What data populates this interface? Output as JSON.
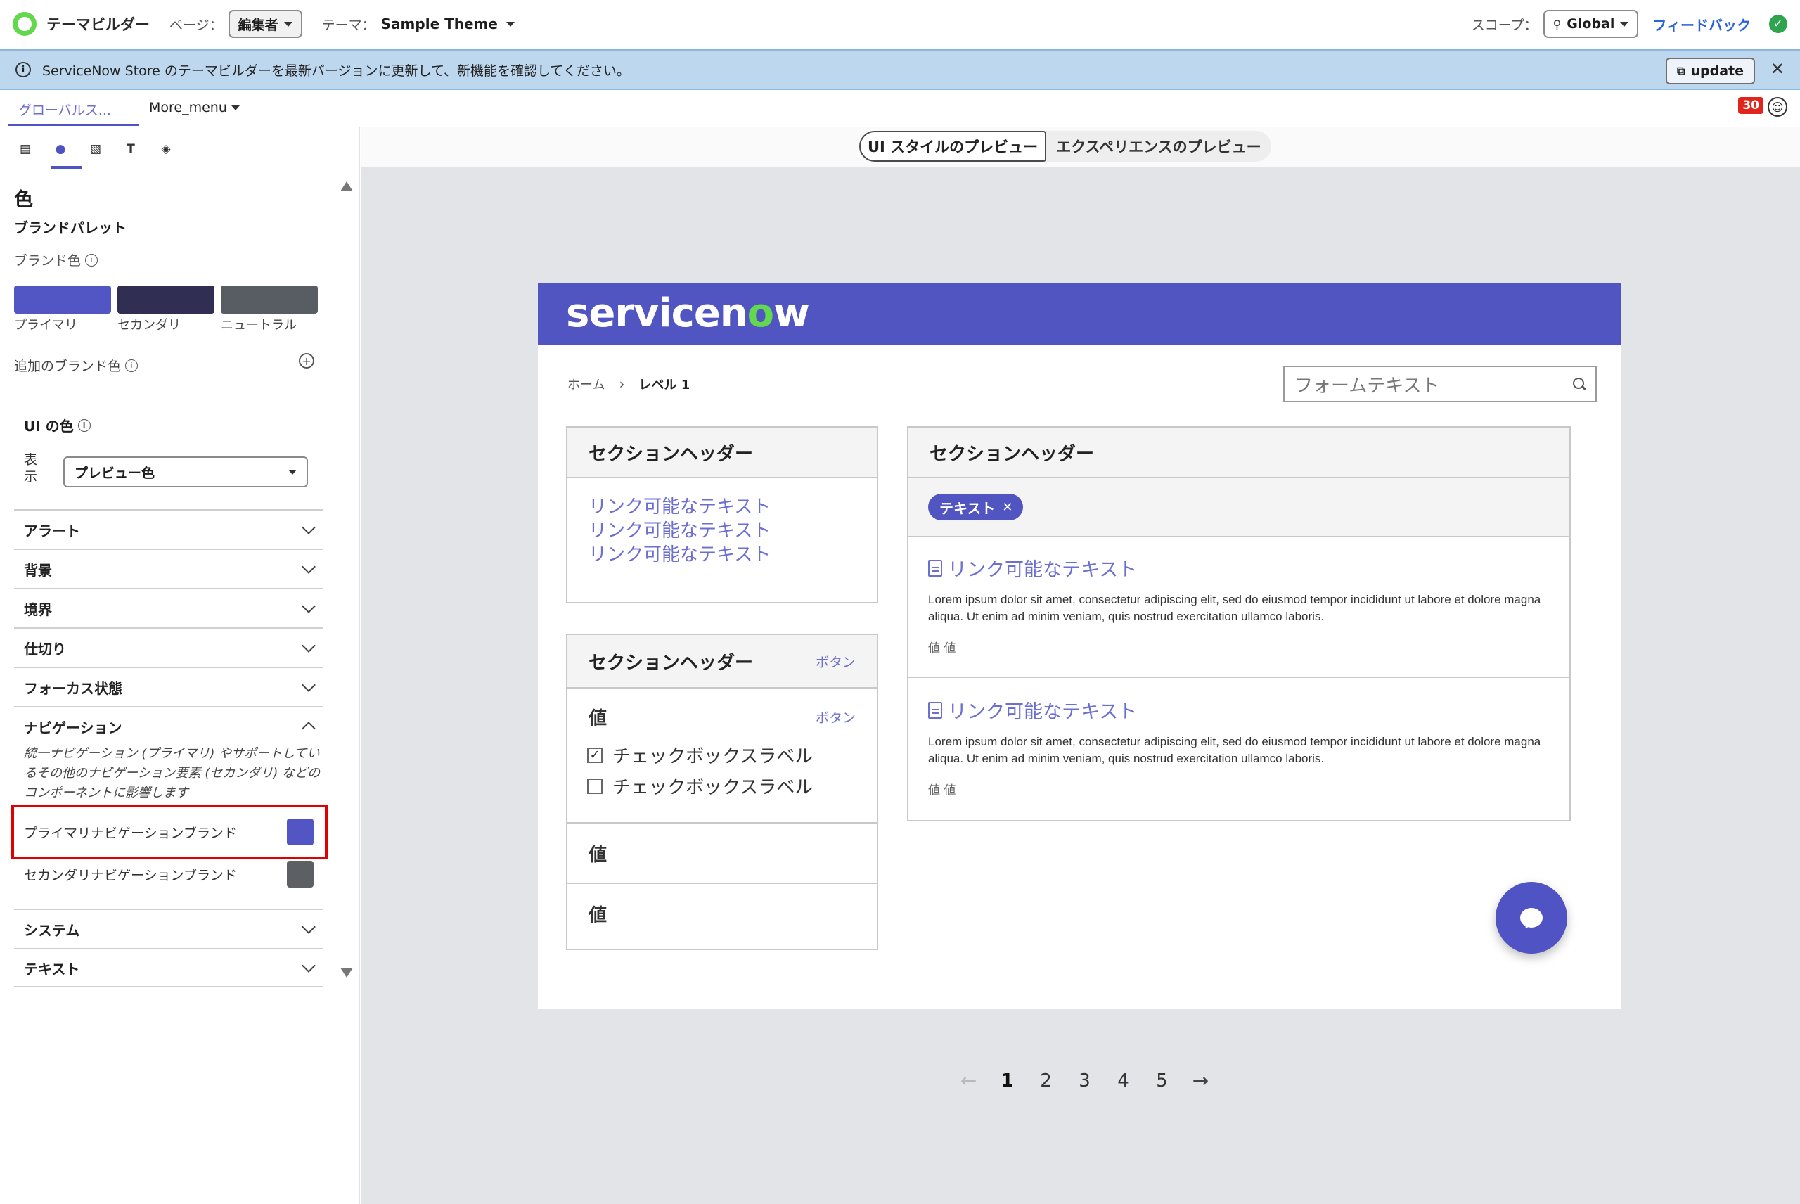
{
  "topbar": {
    "app_title": "テーマビルダー",
    "page_label": "ページ：",
    "page_value": "編集者",
    "theme_label": "テーマ：",
    "theme_value": "Sample Theme",
    "scope_label": "スコープ：",
    "scope_value": "Global",
    "feedback_link": "フィードバック",
    "status_icon": "check-circle-icon"
  },
  "banner": {
    "text": "ServiceNow Store のテーマビルダーを最新バージョンに更新して、新機能を確認してください。",
    "update_label": "update",
    "close_icon": "close-icon"
  },
  "tabs": {
    "global_tab": "グローバルス...",
    "more_menu": "More_menu",
    "notification_count": "30"
  },
  "panel": {
    "icon_tabs": [
      "layout-icon",
      "color-icon",
      "image-icon",
      "typography-icon",
      "shape-icon"
    ],
    "section_title": "色",
    "palette_title": "ブランドパレット",
    "brand_color_label": "ブランド色",
    "swatches": [
      {
        "label": "プライマリ",
        "color": "#5255c4"
      },
      {
        "label": "セカンダリ",
        "color": "#302e52"
      },
      {
        "label": "ニュートラル",
        "color": "#585c63"
      }
    ],
    "additional_brand": "追加のブランド色",
    "ui_color_title": "UI の色",
    "show_label": "表示",
    "show_select": "プレビュー色",
    "accordions": [
      {
        "label": "アラート"
      },
      {
        "label": "背景"
      },
      {
        "label": "境界"
      },
      {
        "label": "仕切り"
      },
      {
        "label": "フォーカス状態"
      },
      {
        "label": "ナビゲーション"
      }
    ],
    "nav_description": "統一ナビゲーション (プライマリ) やサポートしているその他のナビゲーション要素 (セカンダリ) などのコンポーネントに影響します",
    "nav_items": [
      {
        "label": "プライマリナビゲーションブランド",
        "color": "#5255c4"
      },
      {
        "label": "セカンダリナビゲーションブランド",
        "color": "#5c5f64"
      }
    ],
    "accordions_after": [
      {
        "label": "システム"
      },
      {
        "label": "テキスト"
      }
    ]
  },
  "preview": {
    "toggle": {
      "ui_style": "UI スタイルのプレビュー",
      "experience": "エクスペリエンスのプレビュー"
    },
    "brand": {
      "before": "servicen",
      "o": "o",
      "after": "w"
    },
    "breadcrumb": {
      "home": "ホーム",
      "current": "レベル 1"
    },
    "search_placeholder": "フォームテキスト",
    "card1": {
      "title": "セクションヘッダー",
      "links": [
        "リンク可能なテキスト",
        "リンク可能なテキスト",
        "リンク可能なテキスト"
      ]
    },
    "card2": {
      "title": "セクションヘッダー",
      "button": "ボタン",
      "value_label": "値",
      "value_button": "ボタン",
      "checkboxes": [
        {
          "label": "チェックボックスラベル",
          "checked": true
        },
        {
          "label": "チェックボックスラベル",
          "checked": false
        }
      ],
      "rows": [
        "値",
        "値"
      ]
    },
    "card3": {
      "title": "セクションヘッダー",
      "chip": "テキスト",
      "items": [
        {
          "title": "リンク可能なテキスト",
          "body": "Lorem ipsum dolor sit amet, consectetur adipiscing elit, sed do eiusmod tempor incididunt ut labore et dolore magna aliqua. Ut enim ad minim veniam, quis nostrud exercitation ullamco laboris.",
          "meta": "値 値"
        },
        {
          "title": "リンク可能なテキスト",
          "body": "Lorem ipsum dolor sit amet, consectetur adipiscing elit, sed do eiusmod tempor incididunt ut labore et dolore magna aliqua. Ut enim ad minim veniam, quis nostrud exercitation ullamco laboris.",
          "meta": "値 値"
        }
      ]
    },
    "pagination": {
      "pages": [
        "1",
        "2",
        "3",
        "4",
        "5"
      ],
      "current": "1",
      "prev": "←",
      "next": "→"
    }
  }
}
